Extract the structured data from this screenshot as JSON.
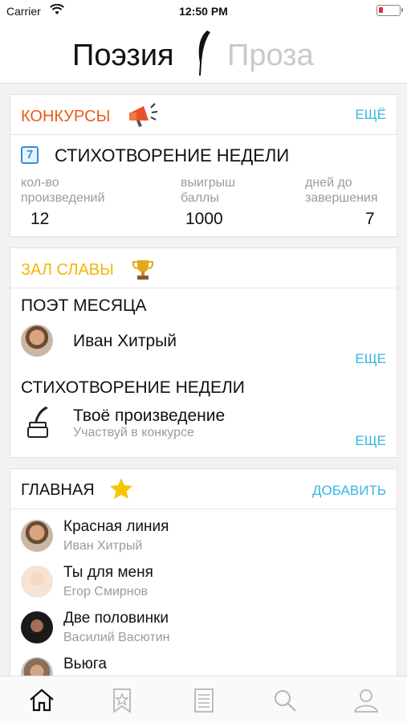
{
  "status_bar": {
    "carrier": "Carrier",
    "time": "12:50 PM"
  },
  "header": {
    "tab_poetry": "Поэзия",
    "tab_prose": "Проза"
  },
  "contests": {
    "title": "КОНКУРСЫ",
    "more": "ЕЩЁ",
    "calendar_day": "7",
    "week_title": "СТИХОТВОРЕНИЕ НЕДЕЛИ",
    "stats": [
      {
        "label_line1": "кол-во",
        "label_line2": "произведений",
        "value": "12"
      },
      {
        "label_line1": "выигрыш",
        "label_line2": "баллы",
        "value": "1000"
      },
      {
        "label_line1": "дней до",
        "label_line2": "завершения",
        "value": "7"
      }
    ]
  },
  "hall_of_fame": {
    "title": "ЗАЛ СЛАВЫ",
    "poet_of_month_label": "ПОЭТ МЕСЯЦА",
    "poet_name": "Иван Хитрый",
    "more1": "ЕЩЕ",
    "poem_of_week_label": "СТИХОТВОРЕНИЕ НЕДЕЛИ",
    "poem_title": "Твоё произведение",
    "poem_sub": "Участвуй в конкурсе",
    "more2": "ЕЩЕ"
  },
  "main_feed": {
    "title": "ГЛАВНАЯ",
    "add": "ДОБАВИТЬ",
    "items": [
      {
        "title": "Красная линия",
        "author": "Иван Хитрый"
      },
      {
        "title": "Ты для меня",
        "author": "Егор Смирнов"
      },
      {
        "title": "Две половинки",
        "author": "Василий Васютин"
      },
      {
        "title": "Вьюга",
        "author": ""
      }
    ]
  },
  "tab_bar": {
    "icons": [
      "home-icon",
      "favorites-icon",
      "list-icon",
      "search-icon",
      "profile-icon"
    ]
  }
}
